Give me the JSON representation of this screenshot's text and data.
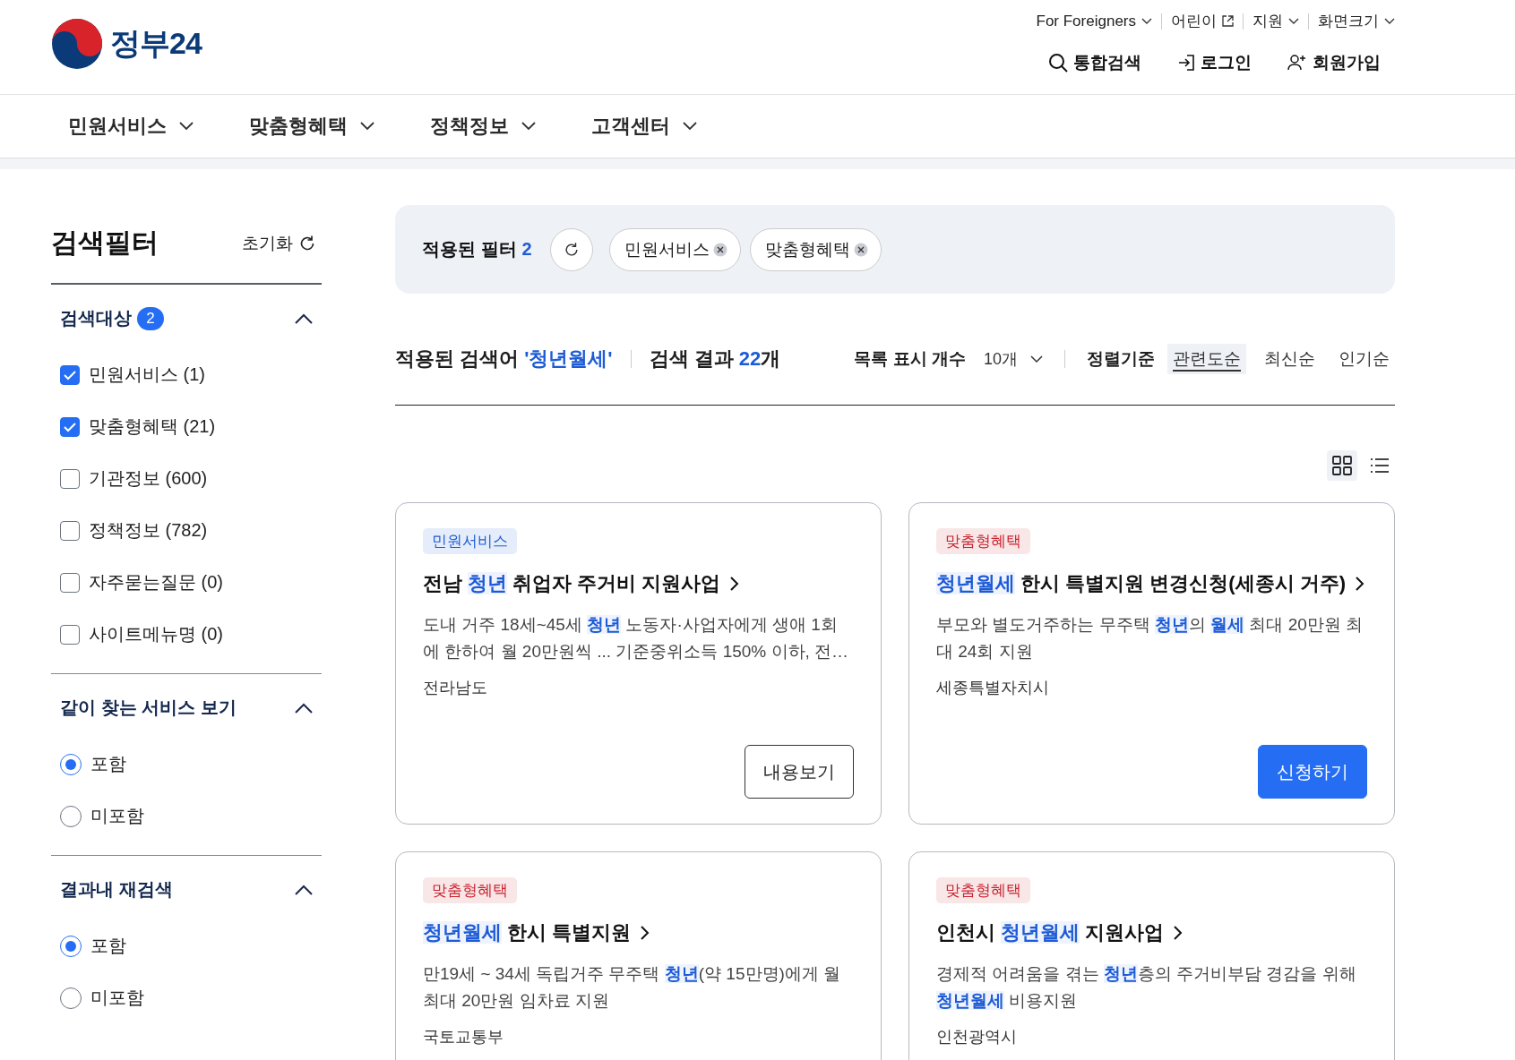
{
  "header": {
    "logo_text": "정부24",
    "utility_links": [
      {
        "label": "For Foreigners",
        "kind": "dropdown"
      },
      {
        "label": "어린이",
        "kind": "external"
      },
      {
        "label": "지원",
        "kind": "dropdown"
      },
      {
        "label": "화면크기",
        "kind": "dropdown"
      }
    ],
    "actions": [
      {
        "label": "통합검색",
        "kind": "search"
      },
      {
        "label": "로그인",
        "kind": "login"
      },
      {
        "label": "회원가입",
        "kind": "signup"
      }
    ]
  },
  "nav": [
    "민원서비스",
    "맞춤형혜택",
    "정책정보",
    "고객센터"
  ],
  "sidebar": {
    "title": "검색필터",
    "reset": "초기화",
    "target": {
      "title": "검색대상",
      "count": "2",
      "expanded": true,
      "options": [
        {
          "label": "민원서비스 (1)",
          "checked": true
        },
        {
          "label": "맞춤형혜택 (21)",
          "checked": true
        },
        {
          "label": "기관정보 (600)",
          "checked": false
        },
        {
          "label": "정책정보 (782)",
          "checked": false
        },
        {
          "label": "자주묻는질문 (0)",
          "checked": false
        },
        {
          "label": "사이트메뉴명 (0)",
          "checked": false
        }
      ]
    },
    "radio_groups": [
      {
        "title": "같이 찾는 서비스 보기",
        "expanded": true,
        "options": [
          {
            "label": "포함",
            "selected": true
          },
          {
            "label": "미포함",
            "selected": false
          }
        ]
      },
      {
        "title": "결과내 재검색",
        "expanded": true,
        "options": [
          {
            "label": "포함",
            "selected": true
          },
          {
            "label": "미포함",
            "selected": false
          }
        ]
      }
    ]
  },
  "applied_filters": {
    "label": "적용된 필터",
    "count": "2",
    "chips": [
      "민원서비스",
      "맞춤형혜택"
    ]
  },
  "results_bar": {
    "term_label": "적용된 검색어",
    "term": "'청년월세'",
    "result_label": "검색 결과",
    "result_count": "22",
    "result_unit": "개",
    "page_size_label": "목록 표시 개수",
    "page_size": "10개",
    "sort_label": "정렬기준",
    "sort_options": [
      {
        "label": "관련도순",
        "selected": true
      },
      {
        "label": "최신순",
        "selected": false
      },
      {
        "label": "인기순",
        "selected": false
      }
    ],
    "views": [
      {
        "kind": "grid",
        "selected": true
      },
      {
        "kind": "list",
        "selected": false
      }
    ]
  },
  "cards": [
    {
      "tag": "민원서비스",
      "color": "#1d5bd6",
      "title": "전남 **청년** 취업자 주거비 지원사업",
      "description": "도내 거주 18세~45세 **청년** 노동자·사업자에게 생애 1회에 한하여 월 20만원씩 ... 기준중위소득 150% 이하, 전…",
      "org": "전라남도",
      "action": {
        "label": "내용보기",
        "kind": "outline"
      }
    },
    {
      "tag": "맞춤형혜택",
      "color": "#c8242f",
      "title": "**청년월세** 한시 특별지원 변경신청(세종시 거주)",
      "description": "부모와 별도거주하는 무주택 **청년**의 **월세** 최대 20만원 최대 24회 지원",
      "org": "세종특별자치시",
      "action": {
        "label": "신청하기",
        "kind": "primary"
      }
    },
    {
      "tag": "맞춤형혜택",
      "color": "#c8242f",
      "title": "**청년월세** 한시 특별지원",
      "description": "만19세 ~ 34세 독립거주 무주택 **청년**(약 15만명)에게 월 최대 20만원 임차료 지원",
      "org": "국토교통부"
    },
    {
      "tag": "맞춤형혜택",
      "color": "#c8242f",
      "title": "인천시 **청년월세** 지원사업",
      "description": "경제적 어려움을 겪는 **청년**층의 주거비부담 경감을 위해 **청년월세** 비용지원",
      "org": "인천광역시"
    }
  ]
}
